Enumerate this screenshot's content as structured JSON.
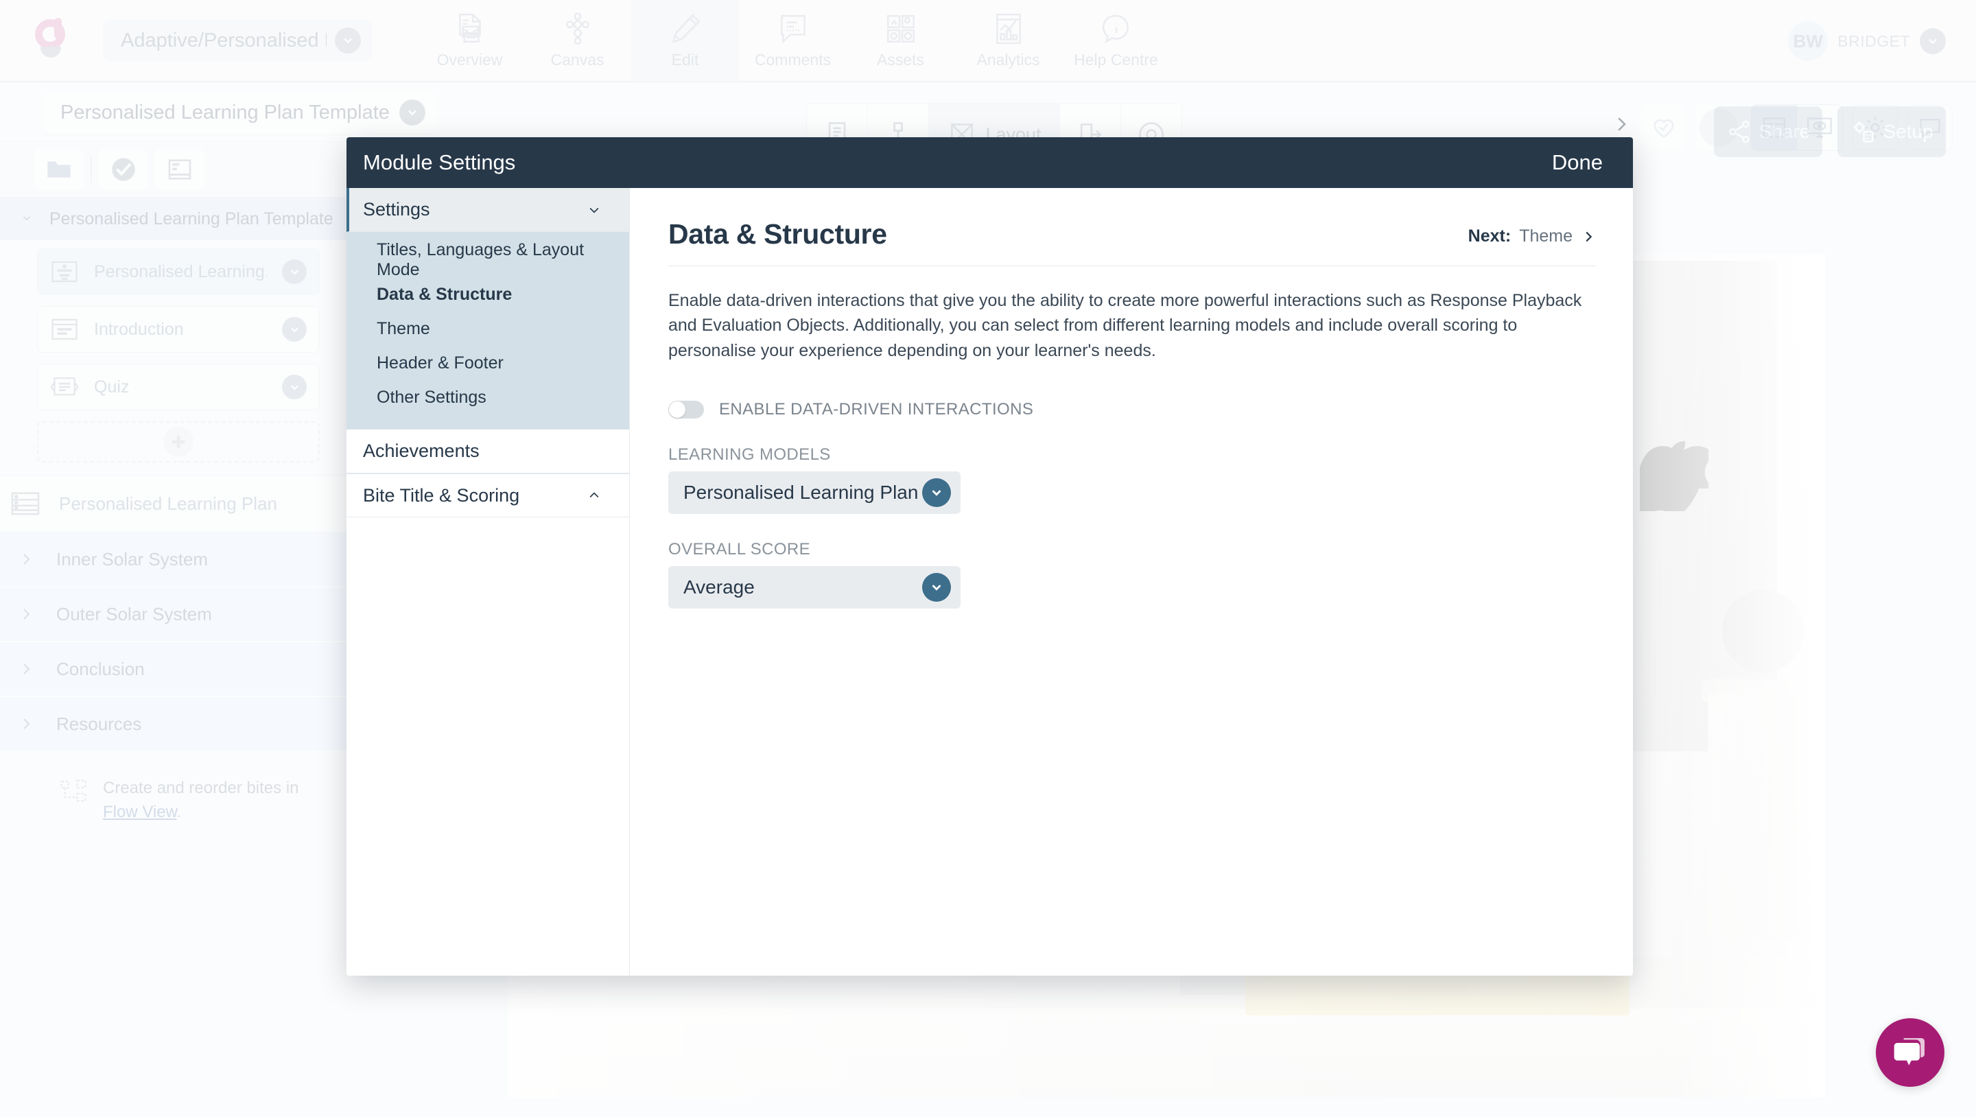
{
  "topnav": {
    "logo_icon": "greenhouse-logo-icon",
    "project_selector": {
      "label": "Adaptive/Personalised L",
      "chevron_icon": "chevron-down-icon"
    },
    "items": [
      {
        "label": "Overview",
        "icon": "overview-document-icon",
        "active": false
      },
      {
        "label": "Canvas",
        "icon": "canvas-nodes-icon",
        "active": false
      },
      {
        "label": "Edit",
        "icon": "pencil-edit-icon",
        "active": true
      },
      {
        "label": "Comments",
        "icon": "comment-bubble-icon",
        "active": false
      },
      {
        "label": "Assets",
        "icon": "assets-grid-icon",
        "active": false
      },
      {
        "label": "Analytics",
        "icon": "analytics-chart-icon",
        "active": false
      },
      {
        "label": "Help Centre",
        "icon": "help-info-icon",
        "active": false
      }
    ],
    "user": {
      "initials": "BW",
      "name": "BRIDGET",
      "chevron_icon": "chevron-down-icon"
    }
  },
  "left_panel": {
    "title": "Personalised Learning Plan Template",
    "title_chevron_icon": "chevron-down-icon",
    "toolbar": [
      {
        "icon": "folder-icon"
      },
      {
        "icon": "check-circle-icon"
      },
      {
        "icon": "layout-panel-icon"
      }
    ],
    "tree_root": {
      "label": "Personalised Learning Plan Template",
      "chevron_icon": "chevron-down-icon"
    },
    "bites": [
      {
        "label": "Personalised Learning...",
        "icon": "bite-card-icon",
        "selected": true,
        "chevron_icon": "chevron-down-icon"
      },
      {
        "label": "Introduction",
        "icon": "bite-window-icon",
        "selected": false,
        "chevron_icon": "chevron-down-icon"
      },
      {
        "label": "Quiz",
        "icon": "bite-quiz-icon",
        "selected": false,
        "chevron_icon": "chevron-down-icon"
      }
    ],
    "add_bite_icon": "plus-icon",
    "plan_row": {
      "label": "Personalised Learning Plan",
      "icon": "list-rows-icon"
    },
    "sections": [
      {
        "label": "Inner Solar System",
        "chevron_icon": "chevron-right-icon"
      },
      {
        "label": "Outer Solar System",
        "chevron_icon": "chevron-right-icon"
      },
      {
        "label": "Conclusion",
        "chevron_icon": "chevron-right-icon"
      },
      {
        "label": "Resources",
        "chevron_icon": "chevron-right-icon"
      }
    ],
    "hint": {
      "icon": "flow-nodes-icon",
      "text": "Create and reorder bites in",
      "link": "Flow View",
      "suffix": "."
    }
  },
  "canvas_toolbar": {
    "layout_label": "Layout",
    "buttons": [
      {
        "icon": "page-icon"
      },
      {
        "icon": "nodes-small-icon"
      },
      {
        "icon": "layout-x-icon",
        "active": true
      },
      {
        "icon": "export-arrow-icon"
      },
      {
        "icon": "preview-eye-icon"
      }
    ]
  },
  "right_tools": {
    "chevron_icon": "chevron-right-icon",
    "buttons": [
      {
        "icon": "heart-check-icon"
      },
      {
        "icon": "circle-avatar-icon"
      },
      {
        "icon": "layout-columns-icon",
        "active": true
      },
      {
        "icon": "preview-monitor-icon",
        "active": false
      },
      {
        "icon": "gear-icon"
      },
      {
        "icon": "comment-icon"
      }
    ],
    "actions": [
      {
        "label": "Share",
        "icon": "share-icon"
      },
      {
        "label": "Setup",
        "icon": "setup-gear-icon"
      }
    ]
  },
  "modal": {
    "title": "Module Settings",
    "done_label": "Done",
    "sidebar": {
      "groups": [
        {
          "label": "Settings",
          "open": true,
          "chevron_icon": "chevron-down-icon",
          "items": [
            {
              "label": "Titles, Languages & Layout Mode",
              "selected": false
            },
            {
              "label": "Data & Structure",
              "selected": true
            },
            {
              "label": "Theme",
              "selected": false
            },
            {
              "label": "Header & Footer",
              "selected": false
            },
            {
              "label": "Other Settings",
              "selected": false
            }
          ]
        },
        {
          "label": "Achievements",
          "open": false,
          "chevron_icon": ""
        },
        {
          "label": "Bite Title & Scoring",
          "open": false,
          "chevron_icon": "chevron-up-icon"
        }
      ]
    },
    "content": {
      "heading": "Data & Structure",
      "next_prefix": "Next:",
      "next_target": "Theme",
      "next_chevron_icon": "chevron-right-icon",
      "description": "Enable data-driven interactions that give you the ability to create more powerful interactions such as Response Playback and Evaluation Objects. Additionally, you can select from different learning models and include overall scoring to personalise your experience depending on your learner's needs.",
      "toggle": {
        "label": "ENABLE DATA-DRIVEN INTERACTIONS",
        "on": false
      },
      "fields": [
        {
          "label": "LEARNING MODELS",
          "value": "Personalised Learning Plan",
          "chevron_icon": "chevron-down-icon"
        },
        {
          "label": "OVERALL SCORE",
          "value": "Average",
          "chevron_icon": "chevron-down-icon"
        }
      ]
    }
  },
  "chat": {
    "icon": "chat-bubble-icon",
    "color": "#a61c74"
  },
  "colors": {
    "modal_header": "#273849",
    "accent_teal": "#3d6e8c",
    "sidebar_selected_bg": "#d3e0e7",
    "chat_magenta": "#a61c74",
    "logo_pink": "#e8a4c4"
  }
}
